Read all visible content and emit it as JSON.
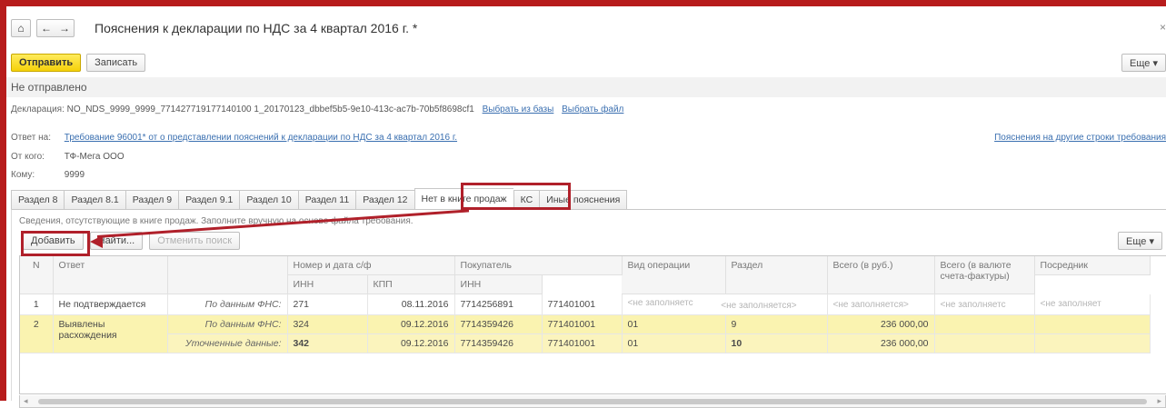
{
  "window": {
    "title": "Пояснения к декларации по НДС за 4 квартал 2016 г. *",
    "home_glyph": "⌂",
    "back_glyph": "←",
    "forward_glyph": "→",
    "close_glyph": "×"
  },
  "toolbar": {
    "send_label": "Отправить",
    "save_label": "Записать",
    "more_label": "Еще ▾"
  },
  "status": "Не отправлено",
  "declaration": {
    "label": "Декларация:",
    "value": "NO_NDS_9999_9999_771427719177140100 1_20170123_dbbef5b5-9e10-413c-ac7b-70b5f8698cf1",
    "pick_db": "Выбрать из базы",
    "pick_file": "Выбрать файл"
  },
  "reply_to": {
    "label": "Ответ на:",
    "link": "Требование 96001* от  о представлении пояснений к декларации по НДС за 4 квартал 2016 г."
  },
  "other_rows_link": "Пояснения на другие строки требования",
  "from": {
    "label": "От кого:",
    "value": "ТФ-Мега ООО"
  },
  "to": {
    "label": "Кому:",
    "value": "9999"
  },
  "tabs": [
    "Раздел 8",
    "Раздел 8.1",
    "Раздел 9",
    "Раздел 9.1",
    "Раздел 10",
    "Раздел 11",
    "Раздел 12",
    "Нет в книге продаж",
    "КС",
    "Иные пояснения"
  ],
  "panel": {
    "description": "Сведения, отсутствующие в книге продаж. Заполните вручную на основе файла требования.",
    "add_label": "Добавить",
    "find_label": "Найти...",
    "cancel_search_label": "Отменить поиск",
    "more_label": "Еще ▾"
  },
  "grid": {
    "headers": {
      "n": "N",
      "answer": "Ответ",
      "invoice": "Номер и дата с/ф",
      "buyer": "Покупатель",
      "inn": "ИНН",
      "kpp": "КПП",
      "op_type": "Вид операции",
      "section": "Раздел",
      "total_rub": "Всего (в руб.)",
      "total_cur": "Всего (в валюте счета-фактуры)",
      "agent": "Посредник",
      "agent_inn": "ИНН"
    },
    "rows": [
      {
        "n": "1",
        "answer": "Не подтверждается",
        "source": "По данным ФНС:",
        "num": "271",
        "date": "08.11.2016",
        "inn": "7714256891",
        "kpp": "771401001",
        "op": "<не заполняетс",
        "section": "<не заполняется>",
        "total": "<не заполняется>",
        "total_cur": "<не заполняетс",
        "agent": "<не заполняет"
      },
      {
        "n": "2",
        "answer": "Выявлены расхождения",
        "source": "По данным ФНС:",
        "num": "324",
        "date": "09.12.2016",
        "inn": "7714359426",
        "kpp": "771401001",
        "op": "01",
        "section": "9",
        "total": "236 000,00",
        "total_cur": "",
        "agent": ""
      },
      {
        "n": "",
        "answer": "",
        "source": "Уточненные данные:",
        "num": "342",
        "date": "09.12.2016",
        "inn": "7714359426",
        "kpp": "771401001",
        "op": "01",
        "section": "10",
        "total": "236 000,00",
        "total_cur": "",
        "agent": ""
      }
    ]
  },
  "colors": {
    "accent_red": "#b0202a",
    "primary_yellow": "#f5d10a",
    "row_highlight": "#faf3b0",
    "link": "#3a6fb0"
  }
}
